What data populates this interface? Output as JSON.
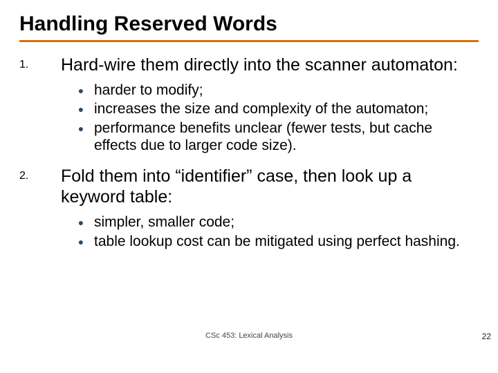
{
  "title": "Handling Reserved Words",
  "items": [
    {
      "num": "1.",
      "text": "Hard-wire them directly into the scanner automaton:",
      "subs": [
        "harder to modify;",
        "increases the size and complexity of the automaton;",
        "performance benefits unclear (fewer tests, but cache effects due to larger code size)."
      ]
    },
    {
      "num": "2.",
      "text": "Fold them into “identifier” case, then look up a keyword table:",
      "subs": [
        "simpler, smaller code;",
        "table lookup cost can be mitigated using perfect hashing."
      ]
    }
  ],
  "footer": "CSc 453: Lexical Analysis",
  "page": "22"
}
